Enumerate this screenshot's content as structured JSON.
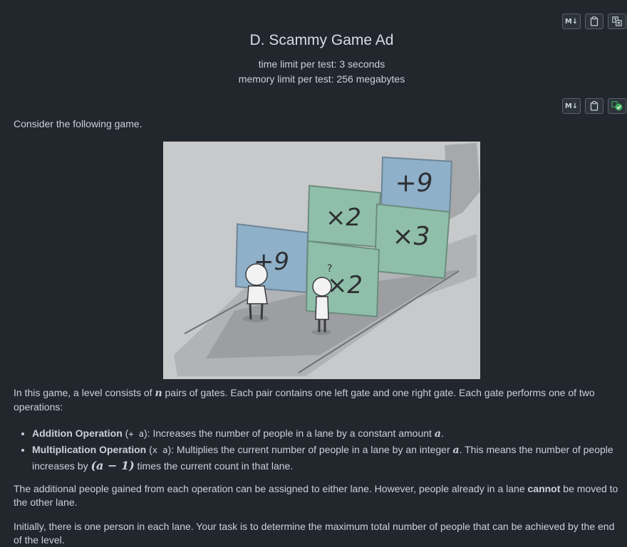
{
  "problem": {
    "title": "D. Scammy Game Ad",
    "time_limit": "time limit per test: 3 seconds",
    "memory_limit": "memory limit per test: 256 megabytes"
  },
  "toolbar": {
    "markdown_label": "M↓"
  },
  "illustration": {
    "gate_labels": [
      "+9",
      "×2",
      "+9",
      "×2",
      "×3"
    ],
    "question_mark": "?"
  },
  "statement": {
    "intro": "Consider the following game.",
    "p1_a": "In this game, a level consists of ",
    "p1_var": "n",
    "p1_b": " pairs of gates. Each pair contains one left gate and one right gate. Each gate performs one of two operations:",
    "add_name": "Addition Operation",
    "add_open": " (",
    "add_code": "+ a",
    "add_close": "): Increases the number of people in a lane by a constant amount ",
    "add_var": "a",
    "add_end": ".",
    "mul_name": "Multiplication Operation",
    "mul_open": " (",
    "mul_code": "x a",
    "mul_close": "): Multiplies the current number of people in a lane by an integer ",
    "mul_var": "a",
    "mul_mid": ". This means the number of people increases by ",
    "mul_expr": "(a − 1)",
    "mul_end": " times the current count in that lane.",
    "p3_a": "The additional people gained from each operation can be assigned to either lane. However, people already in a lane ",
    "p3_bold": "cannot",
    "p3_b": " be moved to the other lane.",
    "p4": "Initially, there is one person in each lane. Your task is to determine the maximum total number of people that can be achieved by the end of the level."
  }
}
